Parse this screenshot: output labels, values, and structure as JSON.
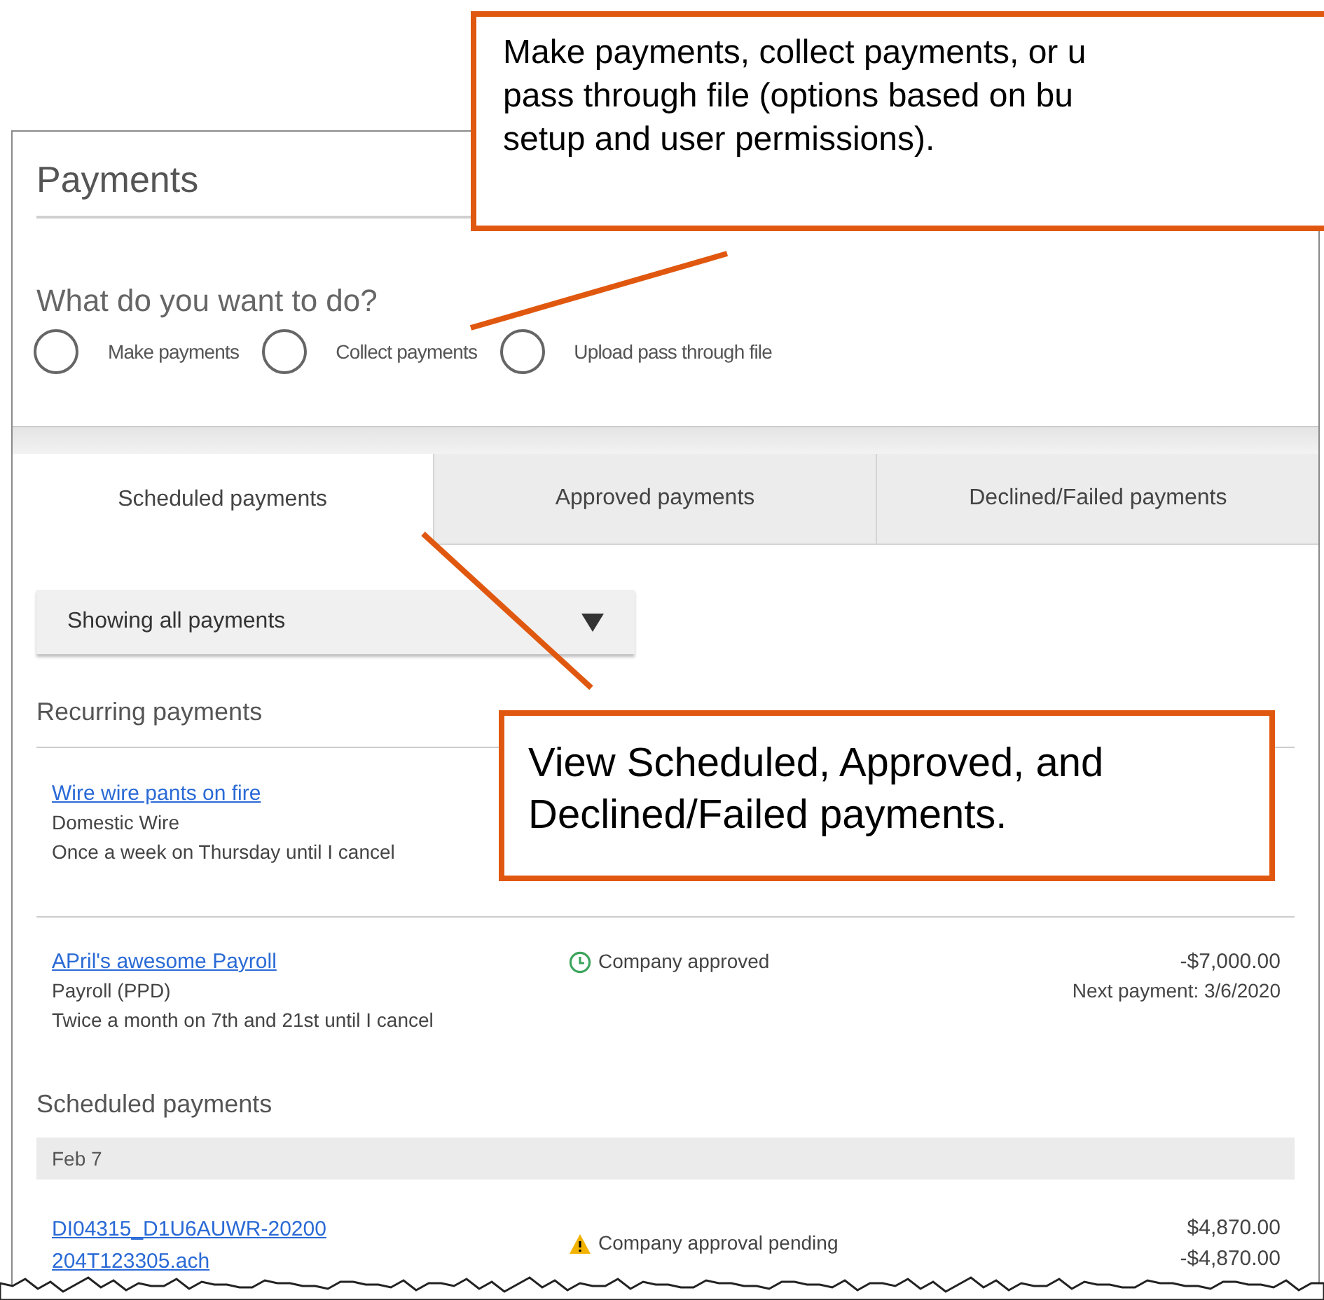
{
  "callouts": [
    {
      "lines": [
        "Make payments, collect payments, or u",
        "pass through file (options based on bu",
        "setup and user permissions)."
      ]
    },
    {
      "lines": [
        "View Scheduled, Approved, and",
        "Declined/Failed payments."
      ]
    }
  ],
  "panel": {
    "title": "Payments",
    "prompt": "What do you want to do?",
    "options": [
      {
        "label": "Make payments",
        "selected": false
      },
      {
        "label": "Collect payments",
        "selected": false
      },
      {
        "label": "Upload pass through file",
        "selected": false
      }
    ]
  },
  "tabs": [
    {
      "label": "Scheduled payments",
      "selected": true
    },
    {
      "label": "Approved payments",
      "selected": false
    },
    {
      "label": "Declined/Failed payments",
      "selected": false
    }
  ],
  "filter": {
    "value": "Showing all payments"
  },
  "recurring": {
    "heading": "Recurring payments",
    "items": [
      {
        "name": "Wire wire pants on fire",
        "type": "Domestic Wire",
        "schedule": "Once a week on Thursday until I cancel"
      },
      {
        "name": "APril's awesome Payroll",
        "type": "Payroll (PPD)",
        "schedule": "Twice a month on 7th and 21st until I cancel",
        "status": {
          "kind": "approved",
          "text": "Company approved"
        },
        "amount": "-$7,000.00",
        "next": "Next payment: 3/6/2020"
      }
    ]
  },
  "scheduled": {
    "heading": "Scheduled payments",
    "groups": [
      {
        "date": "Feb 7",
        "items": [
          {
            "name": "DI04315_D1U6AUWR-20200204T123305.ach",
            "status": {
              "kind": "pending",
              "text": "Company approval pending"
            },
            "amounts": [
              "$4,870.00",
              "-$4,870.00"
            ]
          }
        ]
      }
    ]
  }
}
